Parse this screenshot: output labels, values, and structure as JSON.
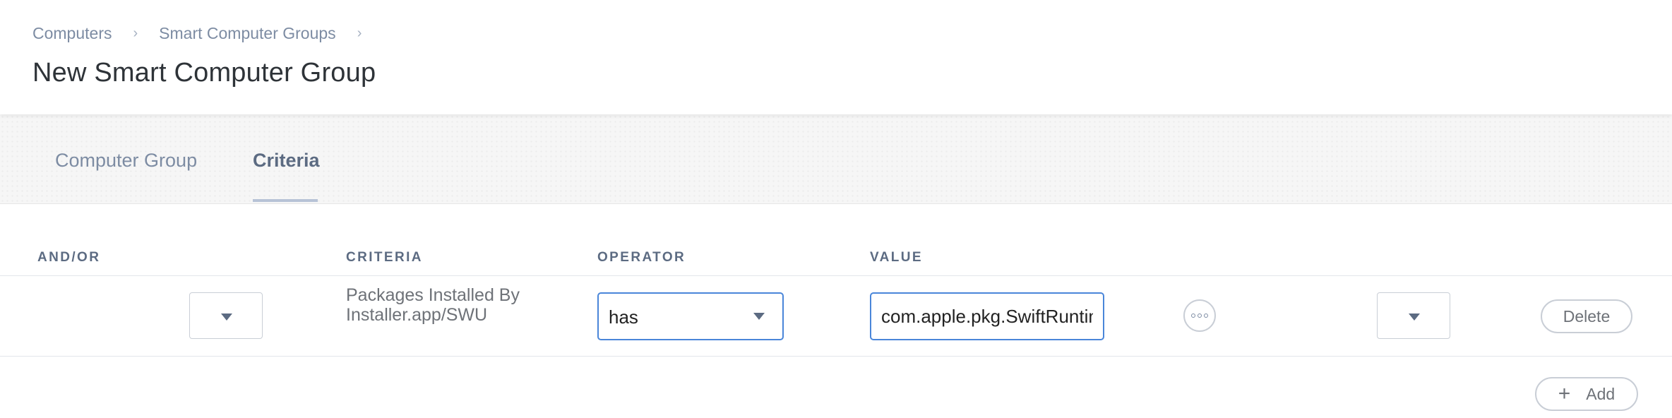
{
  "breadcrumb": {
    "items": [
      "Computers",
      "Smart Computer Groups"
    ],
    "separator": "›"
  },
  "page_title": "New Smart Computer Group",
  "tabs": [
    {
      "label": "Computer Group",
      "active": false
    },
    {
      "label": "Criteria",
      "active": true
    }
  ],
  "table": {
    "headers": {
      "and_or": "AND/OR",
      "criteria": "CRITERIA",
      "operator": "OPERATOR",
      "value": "VALUE"
    },
    "rows": [
      {
        "and_or": "",
        "open_paren": "",
        "criteria": "Packages Installed By Installer.app/SWU",
        "operator": "has",
        "value": "com.apple.pkg.SwiftRuntimeForCommandLineTools",
        "close_paren": "",
        "delete_label": "Delete"
      }
    ]
  },
  "add_button": {
    "icon": "plus-icon",
    "label": "Add"
  },
  "colors": {
    "accent": "#4a86d9",
    "muted_text": "#7d8ca3",
    "header_text": "#5c6b82"
  }
}
